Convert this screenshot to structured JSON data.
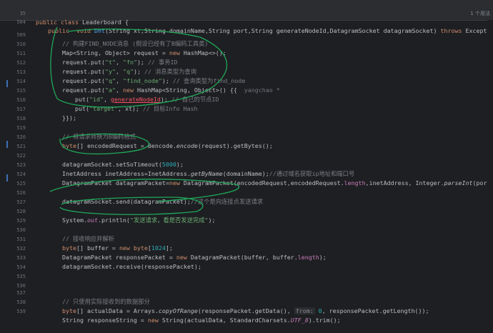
{
  "sticky": {
    "line1_num": "35",
    "line2_num": "504",
    "class_kw1": "public",
    "class_kw2": "class",
    "class_name": "Leaderboard {",
    "m_kw1": "public",
    "m_kw2": "void",
    "m_name": "Dht",
    "m_params": "(String xt,String domainName,String port,String generateNodeId,DatagramSocket datagramSocket)",
    "m_throws": "throws",
    "m_exc": "Exception {",
    "usages": "1 个用法"
  },
  "lines": {
    "l509": {
      "num": "509",
      "text": "// 构建FIND_NODE消息 (假设已经有了B编码工具类)"
    },
    "l510": {
      "num": "510",
      "a": "Map<String, Object> request = ",
      "new": "new",
      "b": " HashMap<>();"
    },
    "l511": {
      "num": "511",
      "a": "request.put(",
      "s1": "\"t\"",
      "c": ", ",
      "s2": "\"fn\"",
      "d": "); ",
      "cm": "// 事务ID"
    },
    "l512": {
      "num": "512",
      "a": "request.put(",
      "s1": "\"y\"",
      "c": ", ",
      "s2": "\"q\"",
      "d": "); ",
      "cm": "// 消息类型为查询"
    },
    "l513": {
      "num": "513",
      "a": "request.put(",
      "s1": "\"q\"",
      "c": ", ",
      "s2": "\"find_node\"",
      "d": "); ",
      "cm": "// 查询类型为find_node"
    },
    "l514": {
      "num": "514",
      "a": "request.put(",
      "s1": "\"a\"",
      "c": ", ",
      "new": "new",
      "b": " HashMap<String, Object>() {{",
      "author": "  yangchao *"
    },
    "l515": {
      "num": "515",
      "a": "put(",
      "s1": "\"id\"",
      "c": ", ",
      "var": "generateNodeId",
      "d": "); ",
      "cm": "// 自己的节点ID"
    },
    "l516": {
      "num": "516",
      "a": "put(",
      "s1": "\"target\"",
      "c": ", xt); ",
      "cm": "// 目标Info Hash"
    },
    "l517": {
      "num": "517",
      "text": "}});"
    },
    "l518": {
      "num": "518",
      "text": ""
    },
    "l519": {
      "num": "519",
      "text": "// 将请求转换为B编码格式"
    },
    "l520": {
      "num": "520",
      "kw": "byte",
      "a": "[] encodedRequest = Bencode.",
      "m": "encode",
      "b": "(request).getBytes();"
    },
    "l521": {
      "num": "521",
      "text": ""
    },
    "l522": {
      "num": "522",
      "a": "datagramSocket.setSoTimeout(",
      "n": "5000",
      "b": ");"
    },
    "l523": {
      "num": "523",
      "a": "InetAddress inetAddress=InetAddress.",
      "m": "getByName",
      "b": "(domainName);",
      "cm": "//通过域名获取ip地址和端口号"
    },
    "l524": {
      "num": "524",
      "a": "DatagramPacket datagramPacket=",
      "new": "new",
      "b": " DatagramPacket(encodedRequest,encodedRequest.",
      "f": "length",
      "c": ",inetAddress, Integer.",
      "m": "parseInt",
      "d": "(port));"
    },
    "l525": {
      "num": "525",
      "text": ""
    },
    "l526": {
      "num": "526",
      "a": "datagramSocket.send(datagramPacket);",
      "cm": "//这个是向连接点发送请求"
    },
    "l527": {
      "num": "527",
      "text": ""
    },
    "l528": {
      "num": "528",
      "a": "System.",
      "f": "out",
      "b": ".println(",
      "s": "\"发送请求，看是否发送完成\"",
      "c": ");"
    },
    "l529": {
      "num": "529",
      "text": ""
    },
    "l530": {
      "num": "530",
      "text": "// 接收响应并解析"
    },
    "l531": {
      "num": "531",
      "kw": "byte",
      "a": "[] buffer = ",
      "new": "new",
      "kw2": " byte",
      "b": "[",
      "n": "1024",
      "c": "];"
    },
    "l532": {
      "num": "532",
      "a": "DatagramPacket responsePacket = ",
      "new": "new",
      "b": " DatagramPacket(buffer, buffer.",
      "f": "length",
      "c": ");"
    },
    "l533": {
      "num": "533",
      "text": "datagramSocket.receive(responsePacket);"
    },
    "l534": {
      "num": "534",
      "text": ""
    },
    "l535": {
      "num": "535",
      "text": ""
    },
    "l536": {
      "num": "536",
      "text": ""
    },
    "l537": {
      "num": "537",
      "text": "// 只使用实际接收到的数据部分"
    },
    "l538": {
      "num": "538",
      "kw": "byte",
      "a": "[] actualData = Arrays.",
      "m": "copyOfRange",
      "b": "(responsePacket.getData(), ",
      "hint": "from:",
      "n": " 0",
      "c": ", responsePacket.getLength());"
    },
    "l539": {
      "num": "539",
      "a": "String responseString = ",
      "new": "new",
      "b": " String(actualData, StandardCharsets.",
      "f": "UTF_8",
      "c": ").trim();"
    }
  },
  "colors": {
    "background": "#1e1f22",
    "keyword": "#cf8e6d",
    "string": "#6aab73",
    "comment": "#7a7e85",
    "annotation": "#1fa85a"
  }
}
